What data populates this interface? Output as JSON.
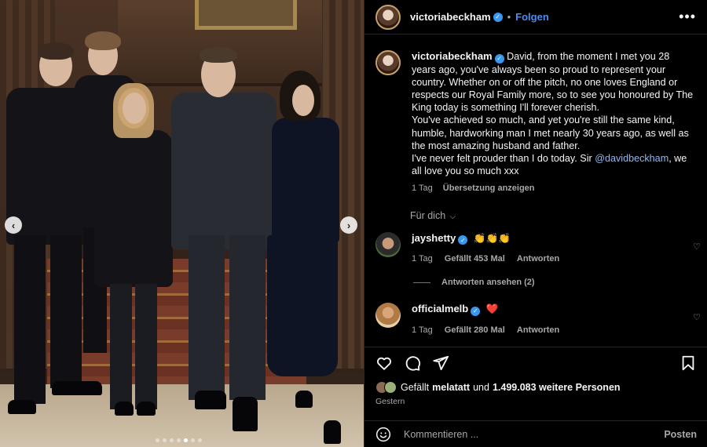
{
  "post": {
    "username": "victoriabeckham",
    "follow_label": "Folgen",
    "separator": "•",
    "more_icon": "more-horizontal-icon"
  },
  "caption": {
    "username": "victoriabeckham",
    "text_before_mention": "David, from the moment I met you 28 years ago, you've always been so proud to represent your country. Whether on or off the pitch, no one loves England or respects our Royal Family more, so to see you honoured by The King today is something I'll forever cherish.\nYou've achieved so much, and yet you're still the same kind, humble, hardworking man I met nearly 30 years ago, as well as the most amazing husband and father.\nI've never felt prouder than I do today. Sir ",
    "mention": "@davidbeckham",
    "text_after_mention": ", we all love you so much xxx",
    "time": "1 Tag",
    "translate": "Übersetzung anzeigen"
  },
  "for_you": "Für dich",
  "comments": [
    {
      "username": "jayshetty",
      "text": "👏👏👏",
      "time": "1 Tag",
      "likes": "Gefällt 453 Mal",
      "reply": "Antworten",
      "view_replies": "Antworten ansehen (2)"
    },
    {
      "username": "officialmelb",
      "text": "❤️",
      "time": "1 Tag",
      "likes": "Gefällt 280 Mal",
      "reply": "Antworten"
    }
  ],
  "likes": {
    "prefix": "Gefällt",
    "user": "melatatt",
    "middle": "und",
    "count": "1.499.083 weitere Personen"
  },
  "date": "Gestern",
  "composer": {
    "placeholder": "Kommentieren ...",
    "post_label": "Posten"
  },
  "carousel": {
    "dot_count": 7,
    "active_index": 4
  },
  "colors": {
    "link_blue": "#4a8cf7",
    "mention_blue": "#8fb7f5",
    "verified_blue": "#3897f0",
    "muted": "#a8a8a8"
  }
}
